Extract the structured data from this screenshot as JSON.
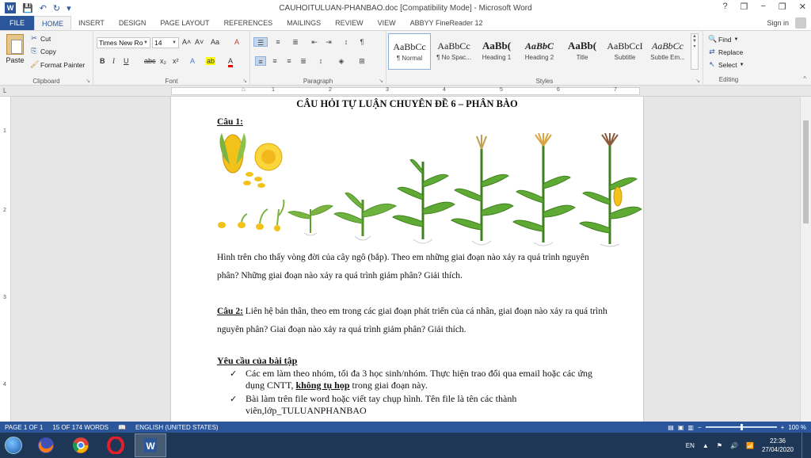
{
  "window": {
    "title": "CAUHOITULUAN-PHANBAO.doc [Compatibility Mode] - Microsoft Word",
    "help": "?",
    "minimize": "−",
    "restore": "❐",
    "close": "✕"
  },
  "tabs": [
    {
      "label": "FILE"
    },
    {
      "label": "HOME"
    },
    {
      "label": "INSERT"
    },
    {
      "label": "DESIGN"
    },
    {
      "label": "PAGE LAYOUT"
    },
    {
      "label": "REFERENCES"
    },
    {
      "label": "MAILINGS"
    },
    {
      "label": "REVIEW"
    },
    {
      "label": "VIEW"
    },
    {
      "label": "ABBYY FineReader 12"
    }
  ],
  "signin": "Sign in",
  "clipboard": {
    "paste": "Paste",
    "cut": "Cut",
    "copy": "Copy",
    "format_painter": "Format Painter",
    "group_label": "Clipboard"
  },
  "font": {
    "family": "Times New Ro",
    "size": "14",
    "group_label": "Font",
    "bold": "B",
    "italic": "I",
    "underline": "U",
    "strike": "abc",
    "subscript": "x₂",
    "superscript": "x²",
    "grow": "A˄",
    "shrink": "A˅",
    "case": "Aa",
    "clear": "A",
    "effects": "A",
    "highlight": "ab",
    "color": "A"
  },
  "paragraph": {
    "group_label": "Paragraph"
  },
  "styles": {
    "group_label": "Styles",
    "items": [
      {
        "sample": "AaBbCc",
        "name": "¶ Normal"
      },
      {
        "sample": "AaBbCc",
        "name": "¶ No Spac..."
      },
      {
        "sample": "AaBb(",
        "name": "Heading 1"
      },
      {
        "sample": "AaBbC",
        "name": "Heading 2"
      },
      {
        "sample": "AaBb(",
        "name": "Title"
      },
      {
        "sample": "AaBbCcI",
        "name": "Subtitle"
      },
      {
        "sample": "AaBbCc",
        "name": "Subtle Em..."
      }
    ]
  },
  "editing": {
    "group_label": "Editing",
    "find": "Find",
    "replace": "Replace",
    "select": "Select"
  },
  "document": {
    "title": "CÂU HỎI TỰ LUẬN CHUYÊN ĐỀ 6 – PHÂN BÀO",
    "q1_label": "Câu 1:",
    "q1_text": "Hình trên cho thấy vòng đời của cây ngô (bắp). Theo em những giai đoạn nào xảy ra quá trình nguyên phân? Những giai đoạn nào xảy ra quá trình giảm phân? Giải thích.",
    "q2_label": "Câu 2:",
    "q2_text": " Liên hệ bản thân, theo em trong các giai đoạn phát triển của cá nhân, giai đoạn nào xảy ra quá trình nguyên phân? Giai đoạn nào xảy ra quá trình giảm phân? Giải thích.",
    "req_title": "Yêu cầu của bài tập",
    "req1_a": "Các em làm theo nhóm, tối đa 3 học sinh/nhóm. Thực hiện trao đổi qua email hoặc các ứng dụng CNTT, ",
    "req1_b": "không tụ họp",
    "req1_c": " trong giai đoạn này.",
    "req2": "Bài làm trên file word hoặc viết tay chụp hình. Tên file là tên các thành viên,lớp_TULUANPHANBAO"
  },
  "status": {
    "page": "PAGE 1 OF 1",
    "words": "15 OF 174 WORDS",
    "language": "ENGLISH (UNITED STATES)",
    "zoom": "100 %"
  },
  "tray": {
    "lang": "EN",
    "time": "22:36",
    "date": "27/04/2020"
  },
  "ruler": {
    "h_numbers": [
      "1",
      "2",
      "3",
      "4",
      "5",
      "6",
      "7"
    ],
    "v_numbers": [
      "1",
      "2",
      "3",
      "4"
    ]
  },
  "colors": {
    "accent": "#2b579a",
    "taskbar": "#1e3756"
  }
}
